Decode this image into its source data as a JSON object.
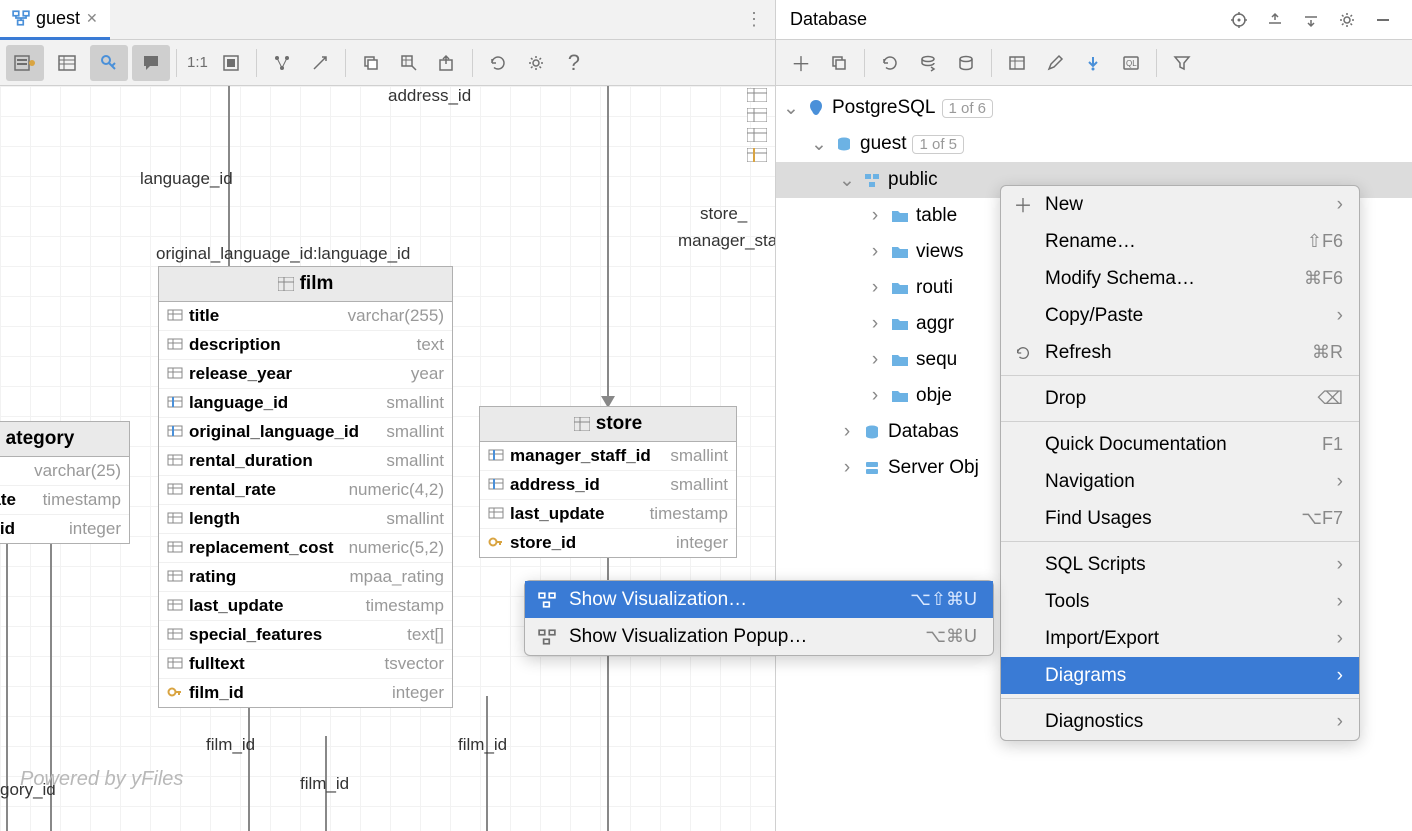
{
  "tab": {
    "title": "guest"
  },
  "toolbar": {
    "ratio": "1:1"
  },
  "entities": {
    "film": {
      "name": "film",
      "cols": [
        {
          "name": "title",
          "type": "varchar(255)",
          "kind": "col"
        },
        {
          "name": "description",
          "type": "text",
          "kind": "col"
        },
        {
          "name": "release_year",
          "type": "year",
          "kind": "col"
        },
        {
          "name": "language_id",
          "type": "smallint",
          "kind": "fk"
        },
        {
          "name": "original_language_id",
          "type": "smallint",
          "kind": "fk"
        },
        {
          "name": "rental_duration",
          "type": "smallint",
          "kind": "col"
        },
        {
          "name": "rental_rate",
          "type": "numeric(4,2)",
          "kind": "col"
        },
        {
          "name": "length",
          "type": "smallint",
          "kind": "col"
        },
        {
          "name": "replacement_cost",
          "type": "numeric(5,2)",
          "kind": "col"
        },
        {
          "name": "rating",
          "type": "mpaa_rating",
          "kind": "col"
        },
        {
          "name": "last_update",
          "type": "timestamp",
          "kind": "col"
        },
        {
          "name": "special_features",
          "type": "text[]",
          "kind": "col"
        },
        {
          "name": "fulltext",
          "type": "tsvector",
          "kind": "col"
        },
        {
          "name": "film_id",
          "type": "integer",
          "kind": "pk"
        }
      ]
    },
    "store": {
      "name": "store",
      "cols": [
        {
          "name": "manager_staff_id",
          "type": "smallint",
          "kind": "fk"
        },
        {
          "name": "address_id",
          "type": "smallint",
          "kind": "fk"
        },
        {
          "name": "last_update",
          "type": "timestamp",
          "kind": "col"
        },
        {
          "name": "store_id",
          "type": "integer",
          "kind": "pk"
        }
      ]
    },
    "category_partial": {
      "name": "ategory",
      "cols": [
        {
          "name": "",
          "type": "varchar(25)",
          "kind": "col"
        },
        {
          "name": "date",
          "type": "timestamp",
          "kind": "col"
        },
        {
          "name": "y_id",
          "type": "integer",
          "kind": "pk"
        }
      ]
    }
  },
  "labels": {
    "address_id": "address_id",
    "language_id": "language_id",
    "orig_lang": "original_language_id:language_id",
    "store_": "store_",
    "manager_sta": "manager_sta",
    "film_id1": "film_id",
    "film_id2": "film_id",
    "film_id3": "film_id",
    "gory_id": "gory_id"
  },
  "watermark": "Powered by yFiles",
  "panel": {
    "title": "Database"
  },
  "tree": {
    "postgres": {
      "label": "PostgreSQL",
      "badge": "1 of 6"
    },
    "guest": {
      "label": "guest",
      "badge": "1 of 5"
    },
    "public": {
      "label": "public"
    },
    "tables": "table",
    "views": "views",
    "routines": "routi",
    "aggregates": "aggr",
    "sequences": "sequ",
    "objects": "obje",
    "dbobjects": "Databas",
    "serverobj": "Server Obj"
  },
  "contextMenu": {
    "new": "New",
    "rename": "Rename…",
    "rename_sc": "⇧F6",
    "modify": "Modify Schema…",
    "modify_sc": "⌘F6",
    "copy": "Copy/Paste",
    "refresh": "Refresh",
    "refresh_sc": "⌘R",
    "drop": "Drop",
    "quickdoc": "Quick Documentation",
    "quickdoc_sc": "F1",
    "nav": "Navigation",
    "findusages": "Find Usages",
    "findusages_sc": "⌥F7",
    "sqlscripts": "SQL Scripts",
    "tools": "Tools",
    "importexport": "Import/Export",
    "diagrams": "Diagrams",
    "diagnostics": "Diagnostics"
  },
  "submenu": {
    "showviz": "Show Visualization…",
    "showviz_sc": "⌥⇧⌘U",
    "showvizpopup": "Show Visualization Popup…",
    "showvizpopup_sc": "⌥⌘U"
  }
}
